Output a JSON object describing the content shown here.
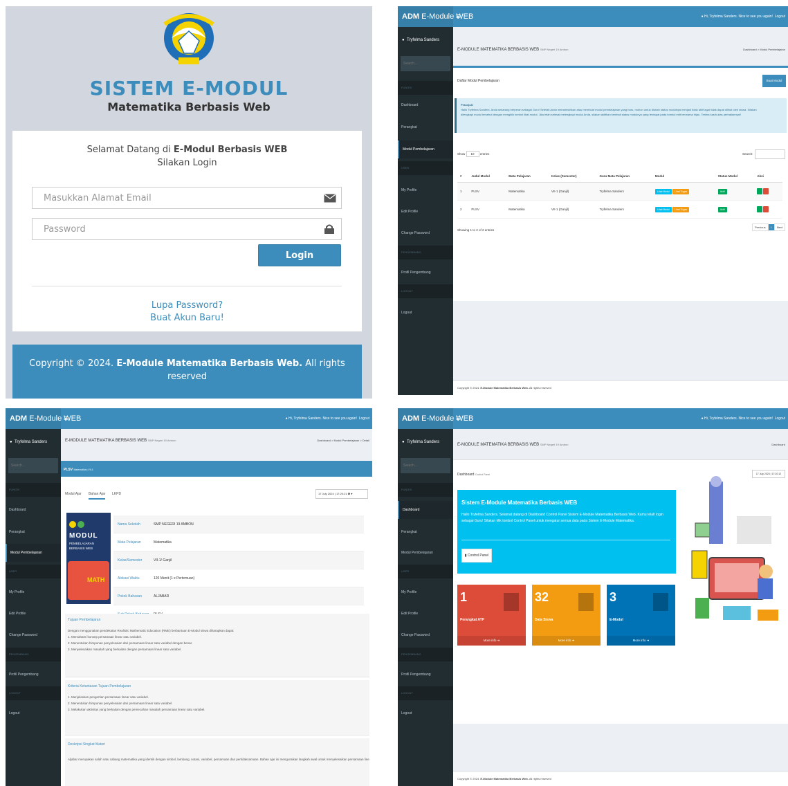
{
  "login": {
    "title": "SISTEM E-MODUL",
    "subtitle": "Matematika Berbasis Web",
    "welcome_prefix": "Selamat Datang di ",
    "welcome_bold": "E-Modul Berbasis WEB",
    "welcome_line2": "Silakan Login",
    "email_placeholder": "Masukkan Alamat Email",
    "password_placeholder": "Password",
    "login_button": "Login",
    "forgot_link": "Lupa Password?",
    "register_link": "Buat Akun Baru!",
    "footer_prefix": "Copyright © 2024. ",
    "footer_bold": "E-Module Matematika Berbasis Web.",
    "footer_suffix": " All rights reserved",
    "colors": {
      "primary": "#3c8dbc",
      "page_bg": "#d2d6de"
    }
  },
  "admin": {
    "brand_bold": "ADM",
    "brand_rest": " E-Module WEB",
    "toggle": "≡",
    "user_greeting": "Hi, Tryfelma Sanders. Nice to see you again!",
    "logout": "Logout",
    "username": "Tryfelma Sanders",
    "search_placeholder": "Search...",
    "sections": {
      "main": "FUNGSI",
      "user": "USER",
      "dev": "PENGEMBANG",
      "logout": "LOGOUT"
    },
    "menu": {
      "dashboard": "Dashboard",
      "perangkat": "Perangkat",
      "modul": "Modul Pembelajaran",
      "profile": "My Profile",
      "edit": "Edit Profile",
      "password": "Change Password",
      "dev": "Profil Pengembang",
      "logout": "Logout"
    },
    "content_title": "E-MODULE MATEMATIKA BERBASIS WEB",
    "content_subtitle": "SMP Negeri 19 Ambon",
    "footer_prefix": "Copyright © 2024. ",
    "footer_bold": "E-Module Matematika Berbasis Web.",
    "footer_suffix": " All rights reserved",
    "colors": {
      "header": "#3c8dbc",
      "sidebar": "#222d32"
    }
  },
  "list_page": {
    "crumb_dashboard": "Dashboard",
    "crumb_current": "Modul Pembelajaran",
    "box_title": "Daftar Modul Pembelajaran",
    "add_button": "Buat Modul",
    "alert_title": "Petunjuk!",
    "alert_text": "Hallo Tryfelma Sanders. Anda sekarang berperan sebagai Guru! Setelah Anda menambahkan atau membuat modul pembelajaran yang baru, mohon untuk diubah status modulnya menjadi tidak aktif agar tidak dapat dilihat oleh siswa. Silakan",
    "alert_text2": "dilengkapi modul tersebut dengan mengklik tombol lihat modul. Jika telah selesai melengkapi modul Anda, silakan aktifkan kembali status modulnya yang terdapat pada tombol edit berwarna hijau. Terima kasih atas perhatiannya!!",
    "show_label": "Show",
    "show_value": "10",
    "entries_label": "entries",
    "search_label": "Search:",
    "columns": [
      "#",
      "Judul Modul",
      "Mata Pelajaran",
      "Kelas (Semester)",
      "Guru Mata Pelajaran",
      "Modul",
      "Status Modul",
      "Aksi"
    ],
    "rows": [
      {
        "no": "1",
        "judul": "PLSV",
        "mapel": "Matematika",
        "kelas": "VII-1 (Ganjil)",
        "guru": "Tryfelma Sanders",
        "btn1": "Lihat Modul",
        "btn2": "Lihat Tugas",
        "status": "Aktif"
      },
      {
        "no": "2",
        "judul": "PLSV",
        "mapel": "Matematika",
        "kelas": "VII-1 (Ganjil)",
        "guru": "Tryfelma Sanders",
        "btn1": "Lihat Modul",
        "btn2": "Lihat Tugas",
        "status": "Aktif"
      }
    ],
    "info": "Showing 1 to 2 of 2 entries",
    "prev": "Previous",
    "page": "1",
    "next": "Next"
  },
  "detail_page": {
    "crumb_dashboard": "Dashboard",
    "crumb_modul": "Modul Pembelajaran",
    "crumb_current": "Detail",
    "box_title": "PLSV",
    "box_subtitle": "Matematika | VII-1",
    "tabs": [
      "Modul Ajar",
      "Bahan Ajar",
      "LKPD"
    ],
    "datetime": "17 July 2024 | 17:20:21",
    "cover": {
      "title": "MODUL",
      "line2": "PEMBELAJARAN",
      "line3": "BERBASIS WEB",
      "math": "MATH"
    },
    "fields": [
      {
        "k": "Nama Sekolah",
        "v": "SMP NEGERI 19 AMBON"
      },
      {
        "k": "Mata Pelajaran",
        "v": "Matematika"
      },
      {
        "k": "Kelas/Semester",
        "v": "VII-1/ Ganjil"
      },
      {
        "k": "Alokasi Waktu",
        "v": "120 Menit (1 x Pertemuan)"
      },
      {
        "k": "Pokok Bahasan",
        "v": "ALJABAR"
      },
      {
        "k": "Sub Pokok Bahasan",
        "v": "PLSV"
      }
    ],
    "sec1_title": "Tujuan Pembelajaran",
    "sec1_lines": [
      "Dengan menggunakan pendekatan Realistic Mathematic Education (RME) berbantuan E-Modul siswa diharapkan dapat:",
      "1. Memahami konsep persamaan linear satu variabel.",
      "2. Menentukan himpunan penyelesaian dari persamaan linear satu variabel dengan benar.",
      "3. Menyelesaikan masalah yang berkaitan dengan persamaan linear satu variabel."
    ],
    "sec2_title": "Kriteria Ketuntasan Tujuan Pembelajaran",
    "sec2_lines": [
      "1. Menjelaskan pengertian persamaan linear satu variabel.",
      "2. Menentukan himpunan penyelesaian dari persamaan linear satu variabel.",
      "3. Melakukan aktivitas yang berkaitan dengan pemecahan masalah persamaan linear satu variabel."
    ],
    "sec3_title": "Deskripsi Singkat Materi",
    "sec3_lines": [
      "Aljabar merupakan salah satu cabang matematika yang identik dengan simbol, lambang, notasi, variabel, persamaan dan pertidaksamaan. Bahan ajar ini menguraikan langkah awal untuk menyelesaikan persamaan linear satu variabel"
    ]
  },
  "dashboard_page": {
    "crumb_dashboard": "Dashboard",
    "title": "Dashboard",
    "title_small": "Control Panel",
    "datetime": "17 July 2024 | 17:20:12",
    "hero_title": "Sistem E-Module Matematika Berbasis WEB",
    "hero_text": "Hallo Tryfelma Sanders. Selamat datang di Dashboard Control Panel Sistem E-Module Matematika Berbasis Web. Kamu telah login sebagai Guru! Silakan klik tombol Control Panel untuk mengatur semua data pada Sistem E-Module Matematika.",
    "hero_button": "Control Panel",
    "stats": [
      {
        "n": "1",
        "label": "Perangkat ATP",
        "more": "More info",
        "color": "#dd4b39"
      },
      {
        "n": "32",
        "label": "Data Siswa",
        "more": "More info",
        "color": "#f39c12"
      },
      {
        "n": "3",
        "label": "E-Modul",
        "more": "More info",
        "color": "#0073b7"
      }
    ]
  }
}
